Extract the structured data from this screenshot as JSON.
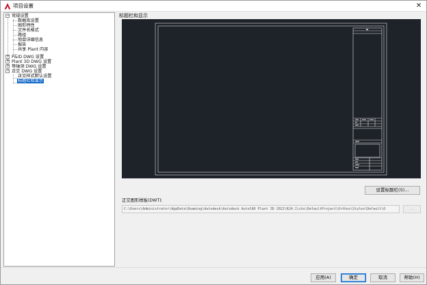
{
  "window": {
    "title": "项目设置",
    "close_glyph": "✕"
  },
  "tree": {
    "items": [
      {
        "label": "常规设置",
        "expander": "−"
      },
      {
        "label": "数据库设置"
      },
      {
        "label": "图形特性"
      },
      {
        "label": "文件名格式"
      },
      {
        "label": "路径"
      },
      {
        "label": "项目详细信息"
      },
      {
        "label": "报告"
      },
      {
        "label": "共享 Plant 内容"
      },
      {
        "label": "P&ID DWG 设置",
        "expander": "+"
      },
      {
        "label": "Plant 3D DWG 设置",
        "expander": "+"
      },
      {
        "label": "等轴测 DWG 设置",
        "expander": "+"
      },
      {
        "label": "正交 DWG 设置",
        "expander": "−"
      },
      {
        "label": "正交样式默认设置"
      },
      {
        "label": "标题栏和显示",
        "selected": true
      }
    ]
  },
  "main": {
    "section_title": "标题栏和显示",
    "setup_button": "设置标题栏(S)...",
    "template_label": "正交图形样板(DWT):",
    "template_path": "C:\\Users\\Administrator\\AppData\\Roaming\\Autodesk\\Autodesk AutoCAD Plant 3D 2022\\R24.1\\chs\\DefaultProject\\Orthos\\Styles\\Default\\O",
    "browse_label": "..."
  },
  "footer": {
    "apply": "应用(A)",
    "ok": "确定",
    "cancel": "取消",
    "help": "帮助(H)"
  },
  "colors": {
    "preview_background": "#1e2229",
    "selection": "#0a64c8",
    "app_icon": "#c8102e"
  },
  "icons": {
    "app": "autocad-logo-icon",
    "close": "close-icon"
  }
}
